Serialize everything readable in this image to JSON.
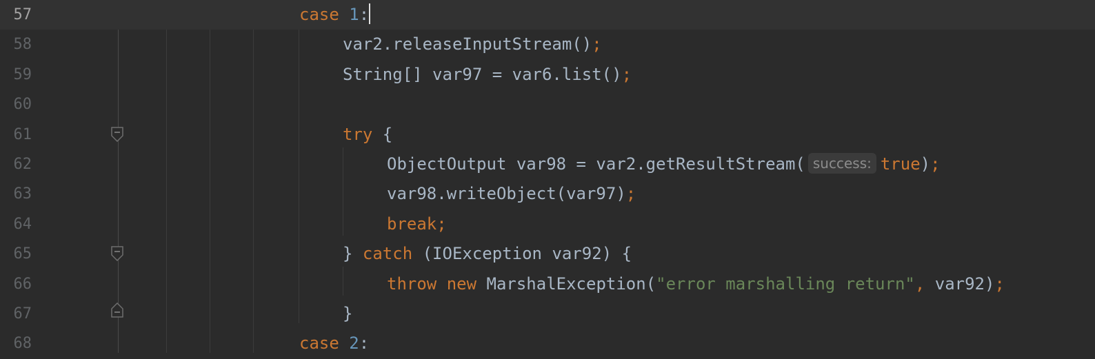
{
  "editor": {
    "current_line": 57,
    "lines": [
      {
        "num": "57",
        "parts": [
          "case",
          " ",
          "1",
          ":"
        ]
      },
      {
        "num": "58",
        "parts": [
          "var2.releaseInputStream()",
          ";"
        ]
      },
      {
        "num": "59",
        "parts": [
          "String[] var97 = var6.list()",
          ";"
        ]
      },
      {
        "num": "60",
        "parts": []
      },
      {
        "num": "61",
        "parts": [
          "try",
          " {"
        ]
      },
      {
        "num": "62",
        "parts": [
          "ObjectOutput var98 = var2.getResultStream(",
          "success:",
          "true",
          ")",
          ";"
        ]
      },
      {
        "num": "63",
        "parts": [
          "var98.writeObject(var97)",
          ";"
        ]
      },
      {
        "num": "64",
        "parts": [
          "break",
          ";"
        ]
      },
      {
        "num": "65",
        "parts": [
          "} ",
          "catch",
          " (IOException var92) {"
        ]
      },
      {
        "num": "66",
        "parts": [
          "throw",
          " ",
          "new",
          " MarshalException(",
          "\"error marshalling return\"",
          ",",
          " var92)",
          ";"
        ]
      },
      {
        "num": "67",
        "parts": [
          "}"
        ]
      },
      {
        "num": "68",
        "parts": [
          "case",
          " ",
          "2",
          ":"
        ]
      }
    ]
  }
}
